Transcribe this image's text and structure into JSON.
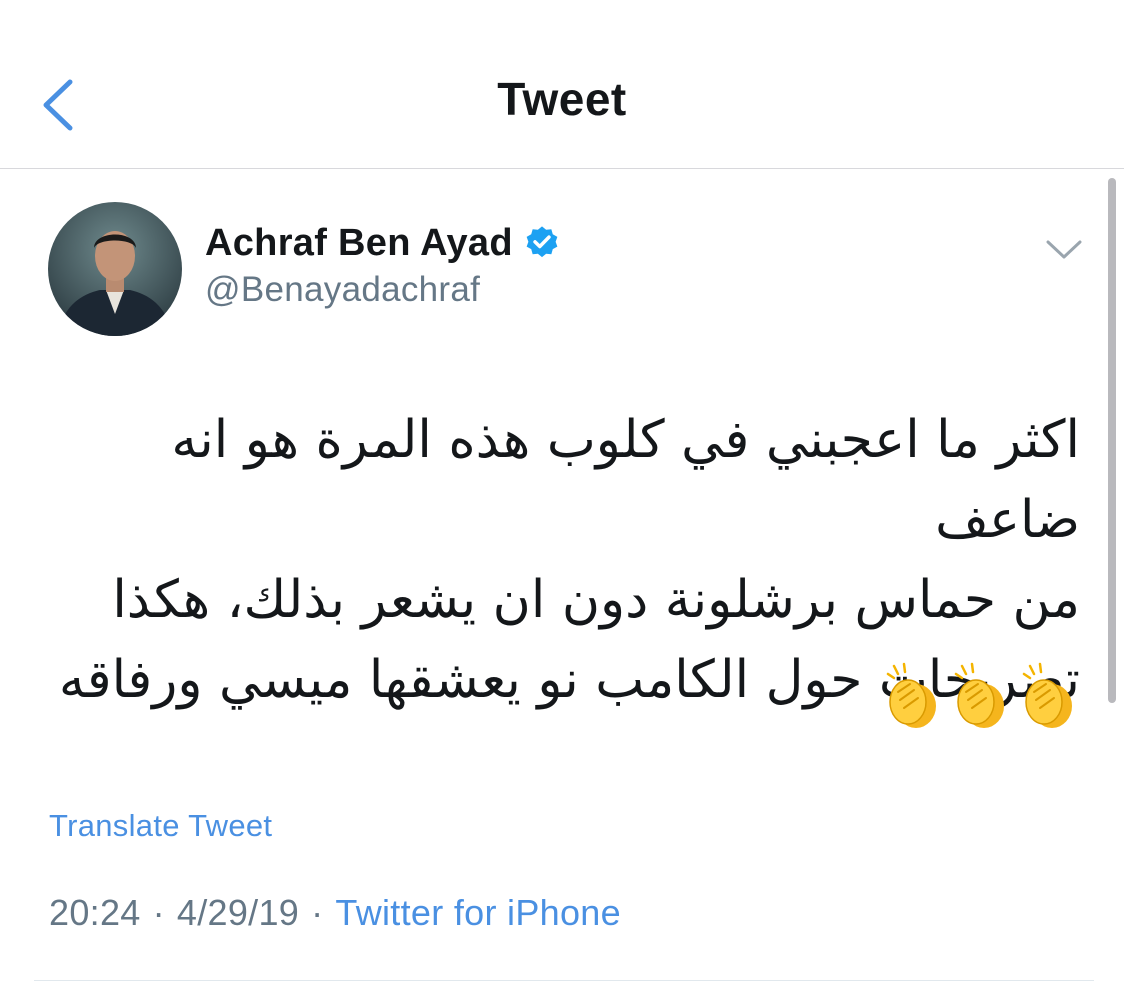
{
  "nav": {
    "title": "Tweet",
    "back_icon": "chevron-left-icon"
  },
  "tweet": {
    "author": {
      "display_name": "Achraf Ben Ayad",
      "handle": "@Benayadachraf",
      "verified": true,
      "verified_icon": "verified-badge-icon"
    },
    "caret_icon": "chevron-down-icon",
    "text_lines": [
      "اكثر ما اعجبني في كلوب هذه المرة هو انه ضاعف",
      "من حماس برشلونة دون ان يشعر بذلك، هكذا",
      "تصريحات حول الكامب نو يعشقها ميسي ورفاقه"
    ],
    "emoji": "👏👏👏",
    "translate_label": "Translate Tweet",
    "time": "20:24",
    "date": "4/29/19",
    "separator": "·",
    "source": "Twitter for iPhone"
  },
  "colors": {
    "link": "#4a90e2",
    "verified": "#1da1f2",
    "muted_text": "#657786",
    "primary_text": "#14171a",
    "divider": "#d8d8dc"
  }
}
